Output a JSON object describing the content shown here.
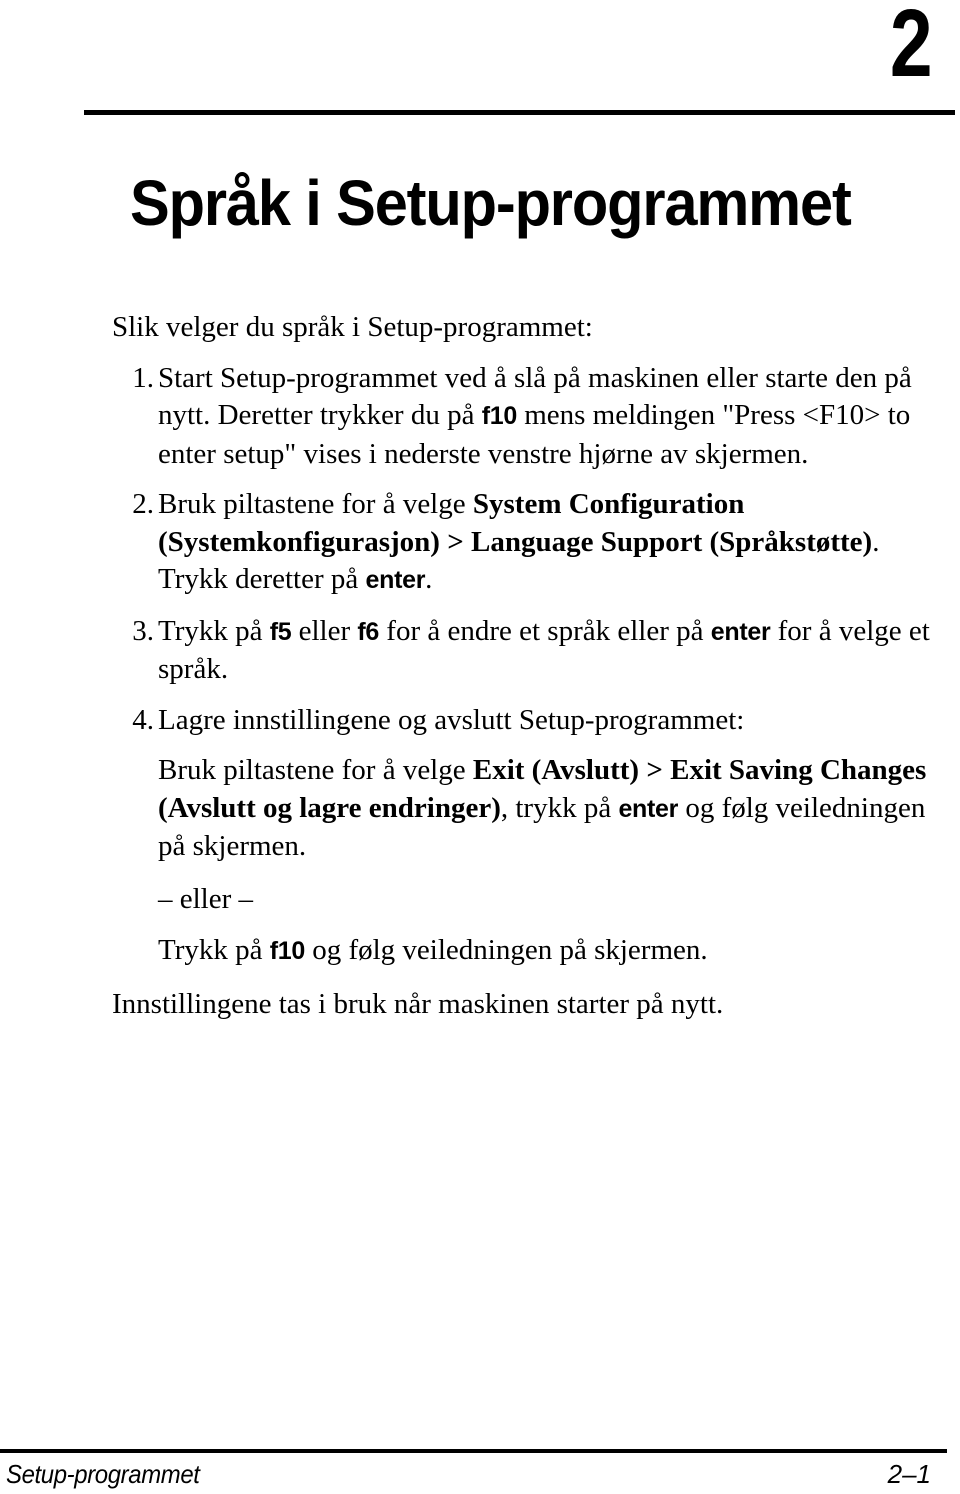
{
  "document": {
    "chapter_number": "2",
    "chapter_title": "Språk i Setup-programmet",
    "lead_line": "Slik velger du språk i Setup-programmet:",
    "steps": [
      {
        "marker": "1.",
        "parts": [
          {
            "type": "plain",
            "text": "Start Setup-programmet ved å slå på maskinen eller starte den på nytt. Deretter trykker du på "
          },
          {
            "type": "key",
            "text": "f10"
          },
          {
            "type": "plain",
            "text": " mens meldingen \"Press <F10> to enter setup\" vises i nederste venstre hjørne av skjermen."
          }
        ]
      },
      {
        "marker": "2.",
        "parts": [
          {
            "type": "plain",
            "text": "Bruk piltastene for å velge "
          },
          {
            "type": "menu",
            "text": "System Configuration (Systemkonfigurasjon) > Language Support (Språkstøtte)"
          },
          {
            "type": "plain",
            "text": ". Trykk deretter på "
          },
          {
            "type": "key",
            "text": "enter"
          },
          {
            "type": "plain",
            "text": "."
          }
        ]
      },
      {
        "marker": "3.",
        "parts": [
          {
            "type": "plain",
            "text": "Trykk på "
          },
          {
            "type": "key",
            "text": "f5"
          },
          {
            "type": "plain",
            "text": " eller "
          },
          {
            "type": "key",
            "text": "f6"
          },
          {
            "type": "plain",
            "text": " for å endre et språk eller på "
          },
          {
            "type": "key",
            "text": "enter"
          },
          {
            "type": "plain",
            "text": " for å velge et språk."
          }
        ]
      },
      {
        "marker": "4.",
        "parts": [
          {
            "type": "plain",
            "text": "Lagre innstillingene og avslutt Setup-programmet:"
          }
        ],
        "sub_paragraph": [
          {
            "type": "plain",
            "text": "Bruk piltastene for å velge "
          },
          {
            "type": "menu",
            "text": "Exit (Avslutt) > Exit Saving Changes (Avslutt og lagre endringer)"
          },
          {
            "type": "plain",
            "text": ", trykk på "
          },
          {
            "type": "key",
            "text": "enter"
          },
          {
            "type": "plain",
            "text": " og følg veiledningen på skjermen."
          }
        ],
        "or_line": "– eller –",
        "alt_paragraph": [
          {
            "type": "plain",
            "text": "Trykk på "
          },
          {
            "type": "key",
            "text": "f10"
          },
          {
            "type": "plain",
            "text": " og følg veiledningen på skjermen."
          }
        ]
      }
    ],
    "closing_line": "Innstillingene tas i bruk når maskinen starter på nytt."
  },
  "footer": {
    "left": "Setup-programmet",
    "right": "2–1"
  },
  "colors": {
    "text": "#000000",
    "background": "#ffffff",
    "rule": "#000000"
  }
}
